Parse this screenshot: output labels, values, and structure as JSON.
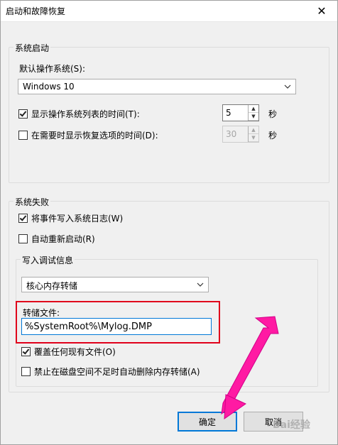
{
  "window": {
    "title": "启动和故障恢复",
    "close_glyph": "✕"
  },
  "startup": {
    "legend": "系统启动",
    "default_os_label": "默认操作系统(S):",
    "default_os_value": "Windows 10",
    "show_list_label": "显示操作系统列表的时间(T):",
    "show_list_checked": true,
    "show_list_value": "5",
    "show_list_unit": "秒",
    "show_recovery_label": "在需要时显示恢复选项的时间(D):",
    "show_recovery_checked": false,
    "show_recovery_value": "30",
    "show_recovery_unit": "秒"
  },
  "failure": {
    "legend": "系统失败",
    "write_event_label": "将事件写入系统日志(W)",
    "write_event_checked": true,
    "auto_restart_label": "自动重新启动(R)",
    "auto_restart_checked": false,
    "debug_legend": "写入调试信息",
    "debug_type_value": "核心内存转储",
    "dump_file_label": "转储文件:",
    "dump_file_value": "%SystemRoot%\\Mylog.DMP",
    "overwrite_label": "覆盖任何现有文件(O)",
    "overwrite_checked": true,
    "disable_delete_label": "禁止在磁盘空间不足时自动删除内存转储(A)",
    "disable_delete_checked": false
  },
  "buttons": {
    "ok": "确定",
    "cancel": "取消"
  },
  "annotation": {
    "arrow_color": "#ff1aa3",
    "highlight_color": "#e0001b"
  },
  "watermark": "Bai经验"
}
